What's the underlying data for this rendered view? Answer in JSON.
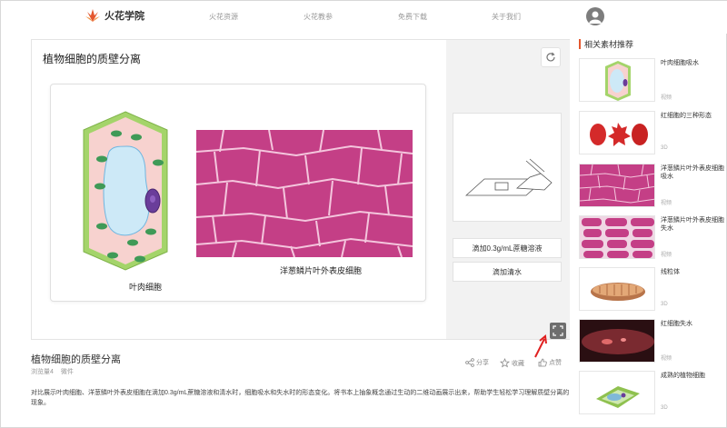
{
  "header": {
    "brand": "火花学院",
    "nav": [
      "火花资源",
      "火花教参",
      "免费下载",
      "关于我们"
    ]
  },
  "stage": {
    "title": "植物细胞的质壁分离",
    "leaf_label": "叶肉细胞",
    "onion_label": "洋葱鳞片叶外表皮细胞",
    "btn_sucrose": "滴加0.3g/mL蔗糖溶液",
    "btn_water": "滴加清水"
  },
  "info": {
    "title": "植物细胞的质壁分离",
    "views": "浏览量4",
    "category": "微件",
    "share": "分享",
    "collect": "收藏",
    "like": "点赞",
    "description": "对比展示叶肉细胞、洋葱鳞叶外表皮细胞在滴加0.3g/mL蔗糖溶液和清水时，细胞吸水和失水时的形态变化。将书本上抽象概念通过生动的二维动画展示出来，帮助学生轻松学习理解质壁分离的现象。"
  },
  "recommend": {
    "heading": "相关素材推荐",
    "items": [
      {
        "title": "叶肉细胞吸水",
        "type": "视频",
        "thumb": "leaf"
      },
      {
        "title": "红细胞的三种形态",
        "type": "3D",
        "thumb": "rbc"
      },
      {
        "title": "洋葱鳞片叶外表皮细胞吸水",
        "type": "视频",
        "thumb": "onion"
      },
      {
        "title": "洋葱鳞片叶外表皮细胞失水",
        "type": "视频",
        "thumb": "onion2"
      },
      {
        "title": "线粒体",
        "type": "3D",
        "thumb": "mito"
      },
      {
        "title": "红细胞失水",
        "type": "视频",
        "thumb": "dark"
      },
      {
        "title": "成熟的植物细胞",
        "type": "3D",
        "thumb": "plant"
      }
    ]
  },
  "colors": {
    "accent": "#e4572e",
    "onion": "#c43f86",
    "cell_wall": "#a4d46a",
    "vacuole": "#cde9f7"
  }
}
